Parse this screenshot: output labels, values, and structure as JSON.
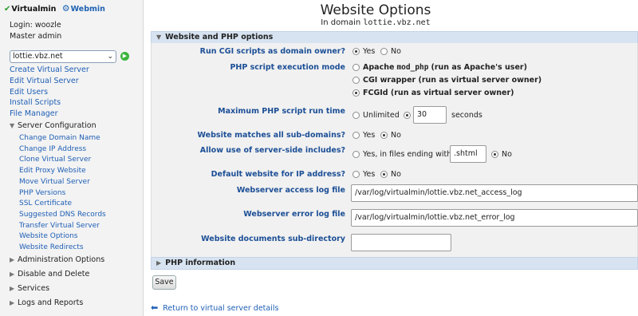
{
  "sidebar": {
    "virtualmin_label": "Virtualmin",
    "webmin_label": "Webmin",
    "login_text": "Login: woozle",
    "role_text": "Master admin",
    "domain_selected": "lottie.vbz.net",
    "links": [
      "Create Virtual Server",
      "Edit Virtual Server",
      "Edit Users",
      "Install Scripts",
      "File Manager"
    ],
    "server_config": {
      "label": "Server Configuration",
      "items": [
        "Change Domain Name",
        "Change IP Address",
        "Clone Virtual Server",
        "Edit Proxy Website",
        "Move Virtual Server",
        "PHP Versions",
        "SSL Certificate",
        "Suggested DNS Records",
        "Transfer Virtual Server",
        "Website Options",
        "Website Redirects"
      ]
    },
    "sections": [
      "Administration Options",
      "Disable and Delete",
      "Services",
      "Logs and Reports"
    ]
  },
  "header": {
    "title": "Website Options",
    "subtitle_prefix": "In domain",
    "subtitle_domain": "lottie.vbz.net"
  },
  "panel": {
    "title": "Website and PHP options",
    "rows": {
      "cgi_label": "Run CGI scripts as domain owner?",
      "cgi_yes": "Yes",
      "cgi_no": "No",
      "php_mode_label": "PHP script execution mode",
      "php_mode_apache_a": "Apache",
      "php_mode_apache_mono": "mod_php",
      "php_mode_apache_b": "(run as Apache's user)",
      "php_mode_cgi": "CGI wrapper (run as virtual server owner)",
      "php_mode_fcgid": "FCGId (run as virtual server owner)",
      "max_time_label": "Maximum PHP script run time",
      "max_time_unlimited": "Unlimited",
      "max_time_value": "30",
      "max_time_unit": "seconds",
      "subdomains_label": "Website matches all sub-domains?",
      "subdomains_yes": "Yes",
      "subdomains_no": "No",
      "ssi_label": "Allow use of server-side includes?",
      "ssi_yes": "Yes, in files ending with",
      "ssi_ext": ".shtml",
      "ssi_no": "No",
      "default_label": "Default website for IP address?",
      "default_yes": "Yes",
      "default_no": "No",
      "access_log_label": "Webserver access log file",
      "access_log_value": "/var/log/virtualmin/lottie.vbz.net_access_log",
      "error_log_label": "Webserver error log file",
      "error_log_value": "/var/log/virtualmin/lottie.vbz.net_error_log",
      "docs_dir_label": "Website documents sub-directory",
      "docs_dir_value": ""
    }
  },
  "php_info_title": "PHP information",
  "save_label": "Save",
  "back_label": "Return to virtual server details",
  "colors": {
    "link": "#1f5fb5",
    "label": "#1c4f96",
    "panel_header": "#d7e3f1",
    "panel_body": "#f1f1f1"
  }
}
